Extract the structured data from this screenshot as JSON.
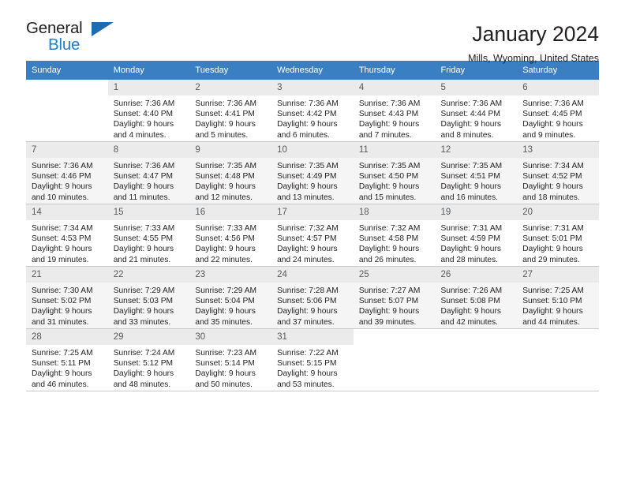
{
  "brand": {
    "name_top": "General",
    "name_bottom": "Blue",
    "triangle_color": "#1c6cb2",
    "blue_color": "#1c7fd4"
  },
  "header": {
    "title": "January 2024",
    "subtitle": "Mills, Wyoming, United States",
    "header_bg": "#3a7fc1"
  },
  "weekdays": [
    "Sunday",
    "Monday",
    "Tuesday",
    "Wednesday",
    "Thursday",
    "Friday",
    "Saturday"
  ],
  "labels": {
    "sunrise_prefix": "Sunrise:",
    "sunset_prefix": "Sunset:",
    "daylight_prefix": "Daylight:"
  },
  "weeks": [
    {
      "shaded": false,
      "days": [
        {
          "num": "",
          "empty": true
        },
        {
          "num": "1",
          "sunrise": "Sunrise: 7:36 AM",
          "sunset": "Sunset: 4:40 PM",
          "daylight1": "Daylight: 9 hours",
          "daylight2": "and 4 minutes."
        },
        {
          "num": "2",
          "sunrise": "Sunrise: 7:36 AM",
          "sunset": "Sunset: 4:41 PM",
          "daylight1": "Daylight: 9 hours",
          "daylight2": "and 5 minutes."
        },
        {
          "num": "3",
          "sunrise": "Sunrise: 7:36 AM",
          "sunset": "Sunset: 4:42 PM",
          "daylight1": "Daylight: 9 hours",
          "daylight2": "and 6 minutes."
        },
        {
          "num": "4",
          "sunrise": "Sunrise: 7:36 AM",
          "sunset": "Sunset: 4:43 PM",
          "daylight1": "Daylight: 9 hours",
          "daylight2": "and 7 minutes."
        },
        {
          "num": "5",
          "sunrise": "Sunrise: 7:36 AM",
          "sunset": "Sunset: 4:44 PM",
          "daylight1": "Daylight: 9 hours",
          "daylight2": "and 8 minutes."
        },
        {
          "num": "6",
          "sunrise": "Sunrise: 7:36 AM",
          "sunset": "Sunset: 4:45 PM",
          "daylight1": "Daylight: 9 hours",
          "daylight2": "and 9 minutes."
        }
      ]
    },
    {
      "shaded": true,
      "days": [
        {
          "num": "7",
          "sunrise": "Sunrise: 7:36 AM",
          "sunset": "Sunset: 4:46 PM",
          "daylight1": "Daylight: 9 hours",
          "daylight2": "and 10 minutes."
        },
        {
          "num": "8",
          "sunrise": "Sunrise: 7:36 AM",
          "sunset": "Sunset: 4:47 PM",
          "daylight1": "Daylight: 9 hours",
          "daylight2": "and 11 minutes."
        },
        {
          "num": "9",
          "sunrise": "Sunrise: 7:35 AM",
          "sunset": "Sunset: 4:48 PM",
          "daylight1": "Daylight: 9 hours",
          "daylight2": "and 12 minutes."
        },
        {
          "num": "10",
          "sunrise": "Sunrise: 7:35 AM",
          "sunset": "Sunset: 4:49 PM",
          "daylight1": "Daylight: 9 hours",
          "daylight2": "and 13 minutes."
        },
        {
          "num": "11",
          "sunrise": "Sunrise: 7:35 AM",
          "sunset": "Sunset: 4:50 PM",
          "daylight1": "Daylight: 9 hours",
          "daylight2": "and 15 minutes."
        },
        {
          "num": "12",
          "sunrise": "Sunrise: 7:35 AM",
          "sunset": "Sunset: 4:51 PM",
          "daylight1": "Daylight: 9 hours",
          "daylight2": "and 16 minutes."
        },
        {
          "num": "13",
          "sunrise": "Sunrise: 7:34 AM",
          "sunset": "Sunset: 4:52 PM",
          "daylight1": "Daylight: 9 hours",
          "daylight2": "and 18 minutes."
        }
      ]
    },
    {
      "shaded": false,
      "days": [
        {
          "num": "14",
          "sunrise": "Sunrise: 7:34 AM",
          "sunset": "Sunset: 4:53 PM",
          "daylight1": "Daylight: 9 hours",
          "daylight2": "and 19 minutes."
        },
        {
          "num": "15",
          "sunrise": "Sunrise: 7:33 AM",
          "sunset": "Sunset: 4:55 PM",
          "daylight1": "Daylight: 9 hours",
          "daylight2": "and 21 minutes."
        },
        {
          "num": "16",
          "sunrise": "Sunrise: 7:33 AM",
          "sunset": "Sunset: 4:56 PM",
          "daylight1": "Daylight: 9 hours",
          "daylight2": "and 22 minutes."
        },
        {
          "num": "17",
          "sunrise": "Sunrise: 7:32 AM",
          "sunset": "Sunset: 4:57 PM",
          "daylight1": "Daylight: 9 hours",
          "daylight2": "and 24 minutes."
        },
        {
          "num": "18",
          "sunrise": "Sunrise: 7:32 AM",
          "sunset": "Sunset: 4:58 PM",
          "daylight1": "Daylight: 9 hours",
          "daylight2": "and 26 minutes."
        },
        {
          "num": "19",
          "sunrise": "Sunrise: 7:31 AM",
          "sunset": "Sunset: 4:59 PM",
          "daylight1": "Daylight: 9 hours",
          "daylight2": "and 28 minutes."
        },
        {
          "num": "20",
          "sunrise": "Sunrise: 7:31 AM",
          "sunset": "Sunset: 5:01 PM",
          "daylight1": "Daylight: 9 hours",
          "daylight2": "and 29 minutes."
        }
      ]
    },
    {
      "shaded": true,
      "days": [
        {
          "num": "21",
          "sunrise": "Sunrise: 7:30 AM",
          "sunset": "Sunset: 5:02 PM",
          "daylight1": "Daylight: 9 hours",
          "daylight2": "and 31 minutes."
        },
        {
          "num": "22",
          "sunrise": "Sunrise: 7:29 AM",
          "sunset": "Sunset: 5:03 PM",
          "daylight1": "Daylight: 9 hours",
          "daylight2": "and 33 minutes."
        },
        {
          "num": "23",
          "sunrise": "Sunrise: 7:29 AM",
          "sunset": "Sunset: 5:04 PM",
          "daylight1": "Daylight: 9 hours",
          "daylight2": "and 35 minutes."
        },
        {
          "num": "24",
          "sunrise": "Sunrise: 7:28 AM",
          "sunset": "Sunset: 5:06 PM",
          "daylight1": "Daylight: 9 hours",
          "daylight2": "and 37 minutes."
        },
        {
          "num": "25",
          "sunrise": "Sunrise: 7:27 AM",
          "sunset": "Sunset: 5:07 PM",
          "daylight1": "Daylight: 9 hours",
          "daylight2": "and 39 minutes."
        },
        {
          "num": "26",
          "sunrise": "Sunrise: 7:26 AM",
          "sunset": "Sunset: 5:08 PM",
          "daylight1": "Daylight: 9 hours",
          "daylight2": "and 42 minutes."
        },
        {
          "num": "27",
          "sunrise": "Sunrise: 7:25 AM",
          "sunset": "Sunset: 5:10 PM",
          "daylight1": "Daylight: 9 hours",
          "daylight2": "and 44 minutes."
        }
      ]
    },
    {
      "shaded": false,
      "days": [
        {
          "num": "28",
          "sunrise": "Sunrise: 7:25 AM",
          "sunset": "Sunset: 5:11 PM",
          "daylight1": "Daylight: 9 hours",
          "daylight2": "and 46 minutes."
        },
        {
          "num": "29",
          "sunrise": "Sunrise: 7:24 AM",
          "sunset": "Sunset: 5:12 PM",
          "daylight1": "Daylight: 9 hours",
          "daylight2": "and 48 minutes."
        },
        {
          "num": "30",
          "sunrise": "Sunrise: 7:23 AM",
          "sunset": "Sunset: 5:14 PM",
          "daylight1": "Daylight: 9 hours",
          "daylight2": "and 50 minutes."
        },
        {
          "num": "31",
          "sunrise": "Sunrise: 7:22 AM",
          "sunset": "Sunset: 5:15 PM",
          "daylight1": "Daylight: 9 hours",
          "daylight2": "and 53 minutes."
        },
        {
          "num": "",
          "empty": true
        },
        {
          "num": "",
          "empty": true
        },
        {
          "num": "",
          "empty": true
        }
      ]
    }
  ]
}
